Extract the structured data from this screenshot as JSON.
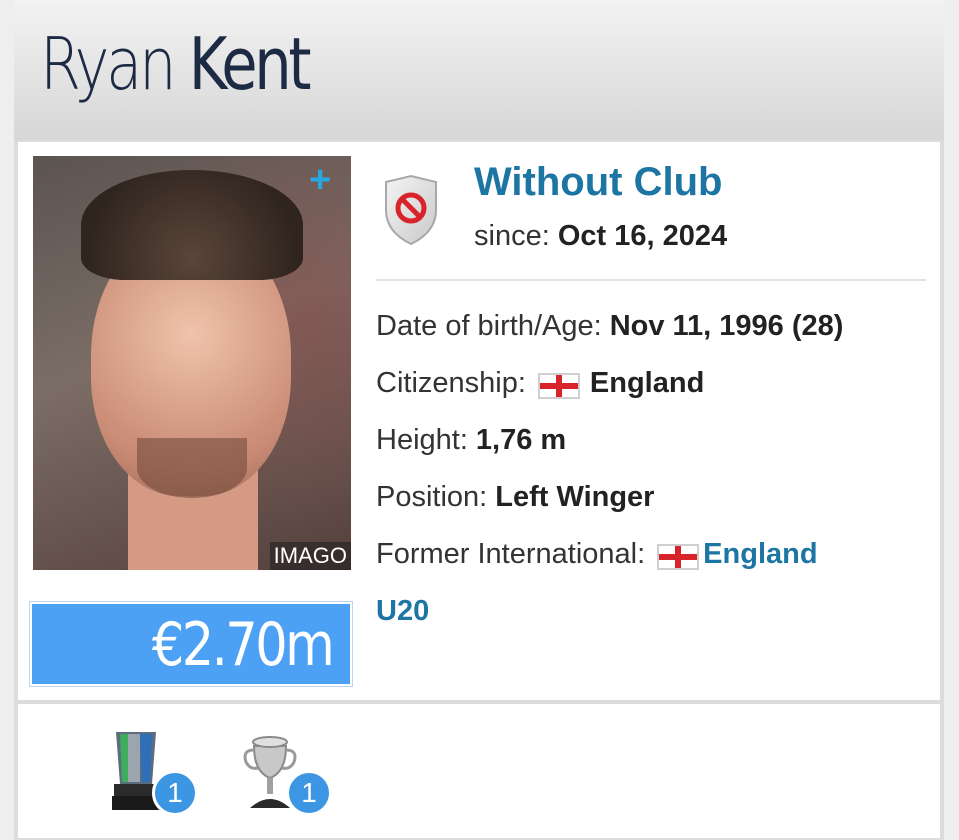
{
  "player": {
    "first_name": "Ryan",
    "last_name": "Kent",
    "photo_credit": "IMAGO",
    "market_value": "€2.70m"
  },
  "club": {
    "name": "Without Club",
    "since_label": "since:",
    "since_date": "Oct 16, 2024"
  },
  "details": {
    "dob_label": "Date of birth/Age:",
    "dob_value": "Nov 11, 1996 (28)",
    "citizenship_label": "Citizenship:",
    "citizenship_value": "England",
    "height_label": "Height:",
    "height_value": "1,76 m",
    "position_label": "Position:",
    "position_value": "Left Winger",
    "international_label": "Former International:",
    "international_value": "England",
    "international_suffix": "U20"
  },
  "trophies": [
    {
      "icon": "cup-trophy-icon",
      "count": "1"
    },
    {
      "icon": "silver-cup-icon",
      "count": "1"
    }
  ]
}
